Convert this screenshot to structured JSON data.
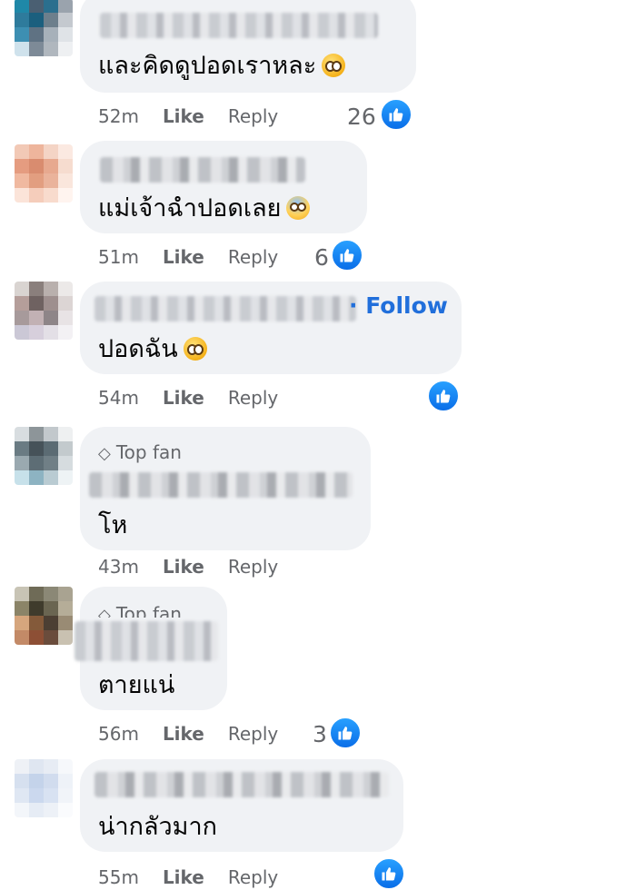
{
  "comments": [
    {
      "id": "c1",
      "text": "และคิดดูปอดเราหละ",
      "emoji": "pleading-face-icon",
      "time": "52m",
      "like": "Like",
      "reply": "Reply",
      "reactions": "26"
    },
    {
      "id": "c2",
      "text": "แม่เจ้าฉำปอดเลย",
      "emoji": "screaming-face-icon",
      "time": "51m",
      "like": "Like",
      "reply": "Reply",
      "reactions": "6"
    },
    {
      "id": "c3",
      "text": "ปอดฉัน",
      "emoji": "pleading-face-icon",
      "follow": "· Follow",
      "time": "54m",
      "like": "Like",
      "reply": "Reply",
      "reactions": ""
    },
    {
      "id": "c4",
      "badge": "Top fan",
      "text": "โห",
      "time": "43m",
      "like": "Like",
      "reply": "Reply",
      "reactions": ""
    },
    {
      "id": "c5",
      "badge": "Top fan",
      "text": "ตายแน่",
      "time": "56m",
      "like": "Like",
      "reply": "Reply",
      "reactions": "3"
    },
    {
      "id": "c6",
      "text": "น่ากลัวมาก",
      "time": "55m",
      "like": "Like",
      "reply": "Reply",
      "reactions": ""
    }
  ]
}
